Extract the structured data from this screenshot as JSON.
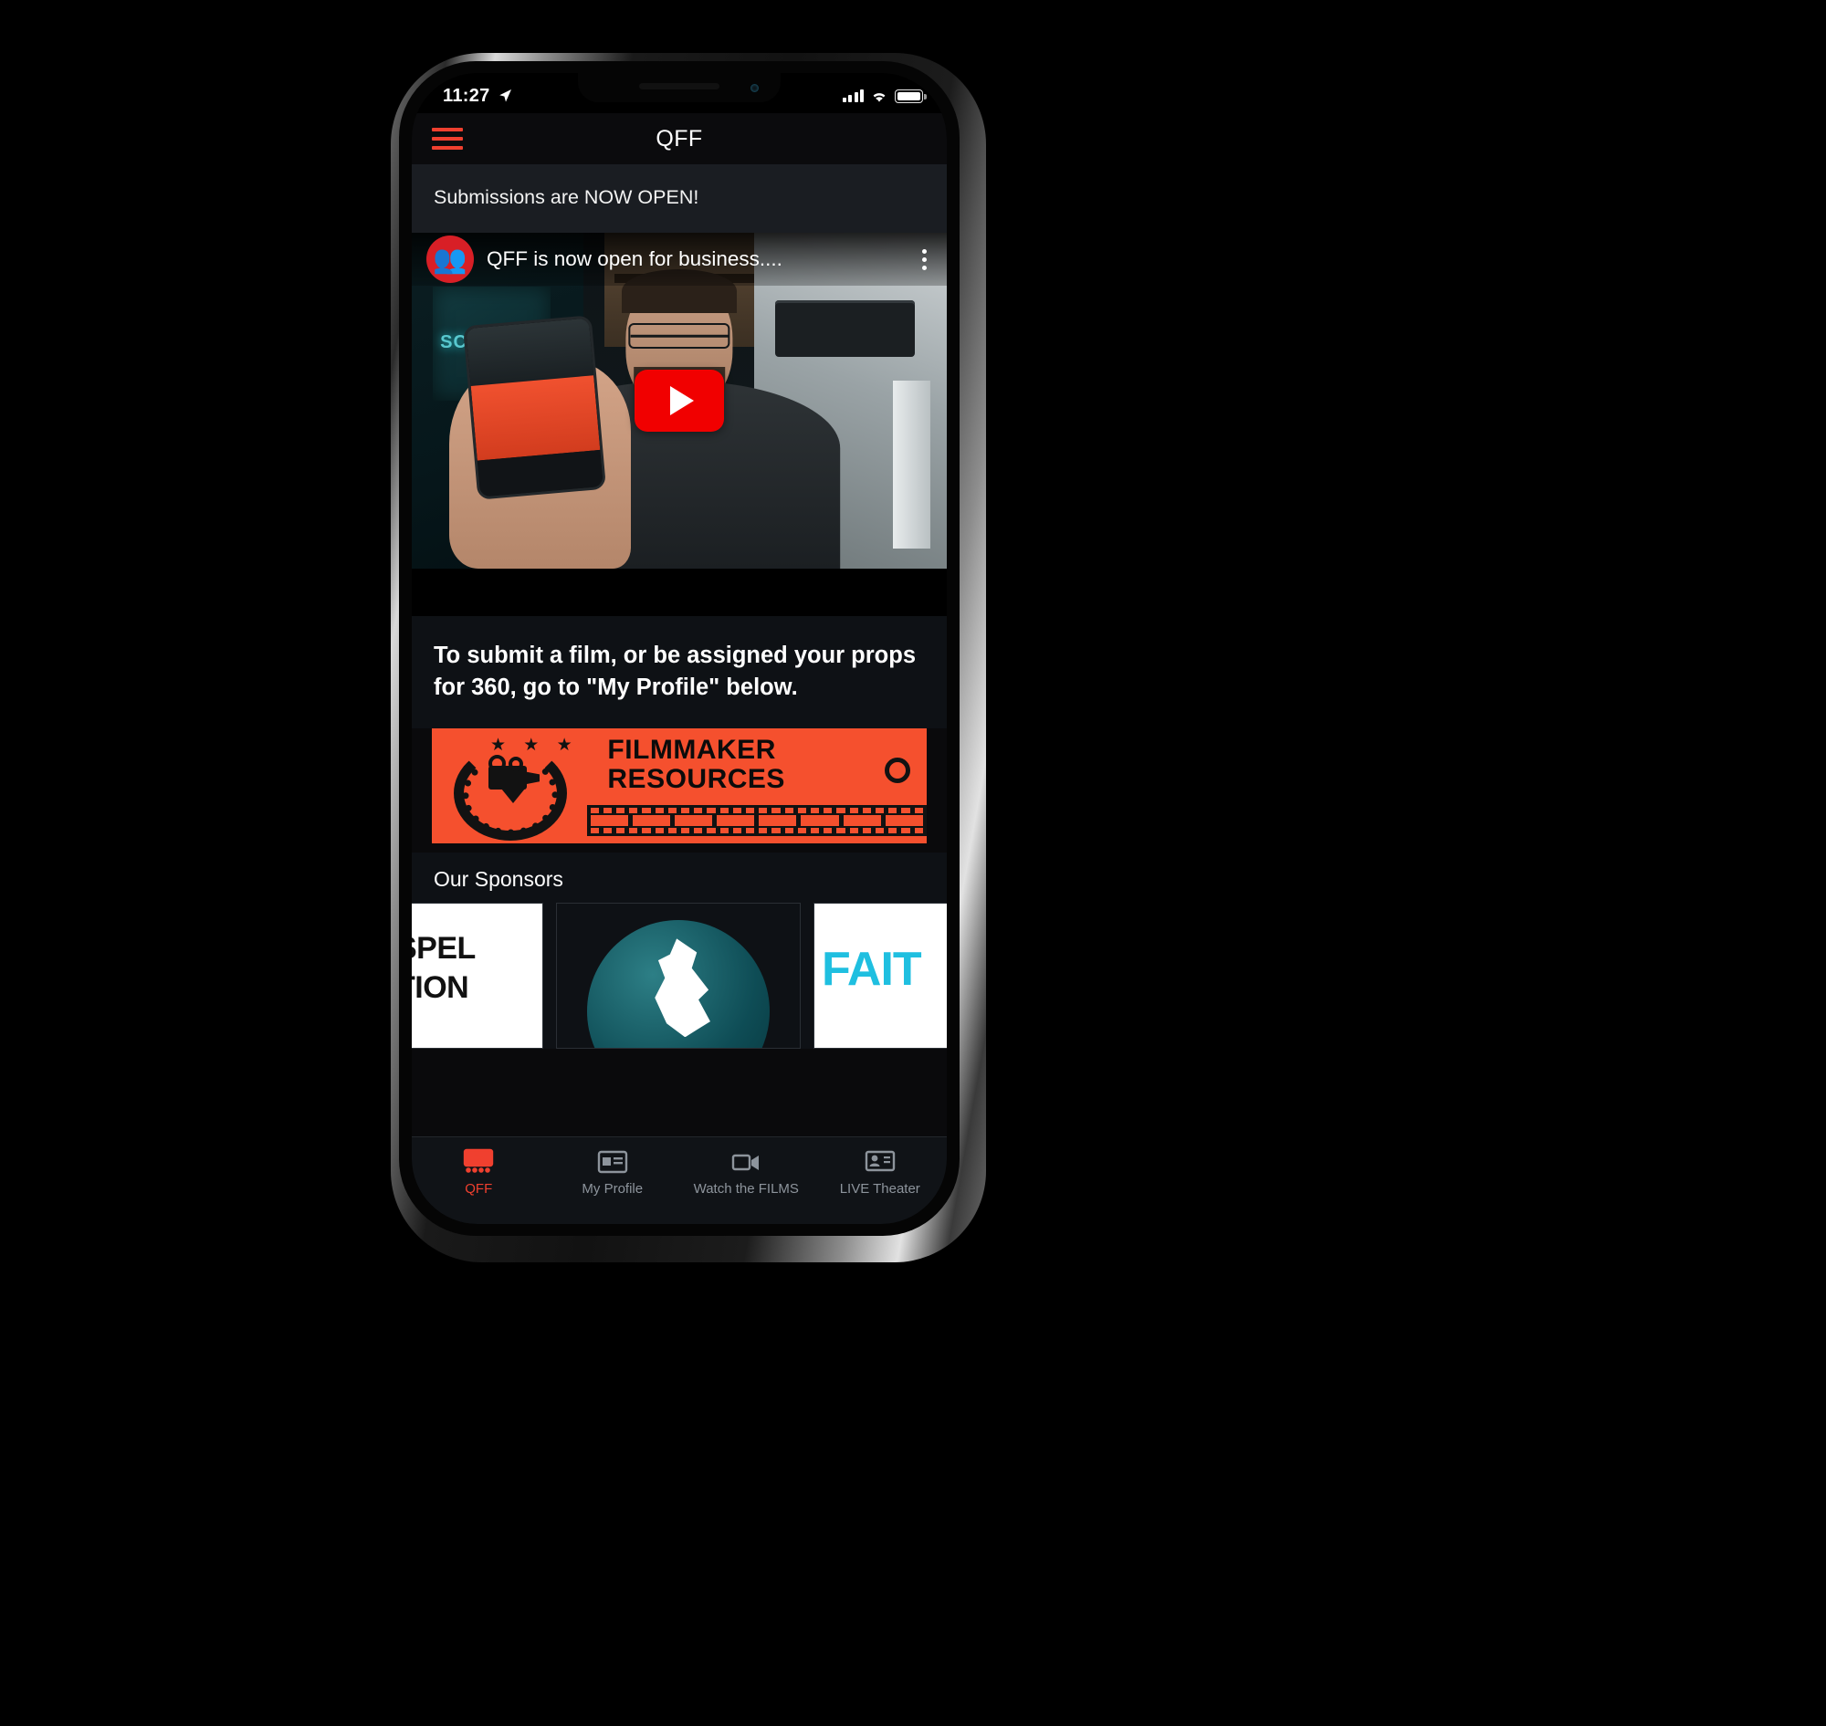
{
  "status_bar": {
    "time": "11:27",
    "location_icon": "location-arrow-icon",
    "signal_icon": "cellular-bars-icon",
    "wifi_icon": "wifi-icon",
    "battery_icon": "battery-full-icon"
  },
  "appbar": {
    "menu_icon": "hamburger-menu-icon",
    "title": "QFF",
    "menu_color": "#f0402f"
  },
  "announcement": {
    "text": "Submissions are NOW OPEN!"
  },
  "video": {
    "channel_avatar": "qff-channel-avatar-icon",
    "title": "QFF is now open for business....",
    "kebab_icon": "more-options-icon",
    "play_button": "youtube-play-button-icon",
    "play_color": "#f10000"
  },
  "instruction": {
    "text": "To submit a film, or be assigned your props for 360, go to \"My Profile\" below."
  },
  "filmmaker_banner": {
    "line1": "FILMMAKER",
    "line2": "RESOURCES",
    "stars": "★ ★ ★",
    "logo_icon": "film-camera-laurel-icon",
    "ring_icon": "circle-outline-icon",
    "filmstrip_icon": "film-strip-icon",
    "background_color": "#f5502e",
    "text_color": "#0b0b0b"
  },
  "sponsors": {
    "title": "Our Sponsors",
    "cards": [
      {
        "name": "sponsor-gospel-nation",
        "line1": "SPEL",
        "line2": "TION"
      },
      {
        "name": "sponsor-globe-dove",
        "icon": "globe-dove-icon"
      },
      {
        "name": "sponsor-faith",
        "line1": "FAIT"
      }
    ]
  },
  "tabbar": {
    "items": [
      {
        "label": "QFF",
        "icon": "film-projector-icon",
        "active": true
      },
      {
        "label": "My Profile",
        "icon": "profile-card-icon",
        "active": false
      },
      {
        "label": "Watch the FILMS",
        "icon": "video-camera-icon",
        "active": false
      },
      {
        "label": "LIVE Theater",
        "icon": "presentation-screen-icon",
        "active": false
      }
    ],
    "active_color": "#f0402f",
    "inactive_color": "#8d949c"
  }
}
